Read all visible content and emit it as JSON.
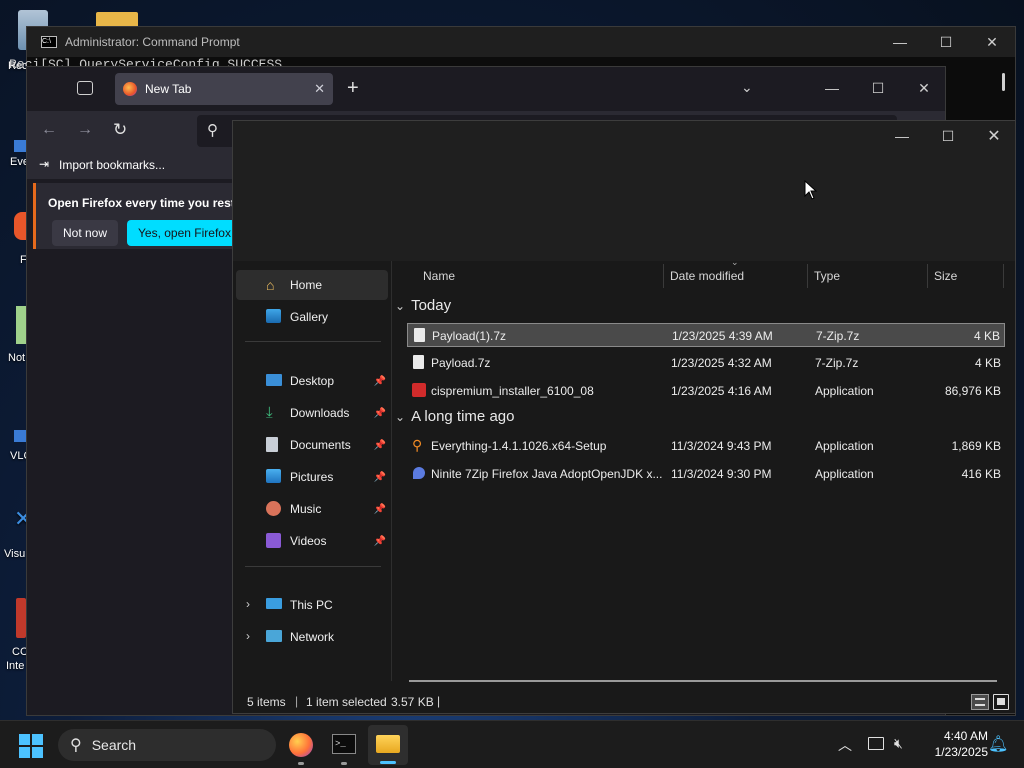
{
  "desktop": {
    "icons": [
      {
        "label": "Recy",
        "icon": "recycle-bin-icon"
      },
      {
        "label": "Eve",
        "icon": "everything-shortcut-icon"
      },
      {
        "label": "F",
        "icon": "firefox-shortcut-icon"
      },
      {
        "label": "Not",
        "icon": "notepad-shortcut-icon"
      },
      {
        "label": "VLC",
        "icon": "vlc-shortcut-icon"
      },
      {
        "label": "Visu",
        "icon": "visual-studio-shortcut-icon"
      },
      {
        "label": "CC",
        "icon": "ccleaner-shortcut-icon"
      },
      {
        "label": "Inte",
        "icon": "intel-shortcut-icon"
      }
    ]
  },
  "cmd": {
    "title": "Administrator: Command Prompt",
    "output": "Reci[SC] QueryServiceConfig SUCCESS"
  },
  "firefox": {
    "tab_title": "New Tab",
    "import_bookmarks": "Import bookmarks...",
    "notification_text": "Open Firefox every time you resta",
    "not_now": "Not now",
    "yes_open": "Yes, open Firefox"
  },
  "explorer": {
    "nav": {
      "home": "Home",
      "gallery": "Gallery",
      "desktop": "Desktop",
      "downloads": "Downloads",
      "documents": "Documents",
      "pictures": "Pictures",
      "music": "Music",
      "videos": "Videos",
      "this_pc": "This PC",
      "network": "Network"
    },
    "columns": {
      "name": "Name",
      "date": "Date modified",
      "type": "Type",
      "size": "Size"
    },
    "groups": [
      {
        "label": "Today",
        "files": [
          {
            "name": "Payload(1).7z",
            "date": "1/23/2025 4:39 AM",
            "type": "7-Zip.7z",
            "size": "4 KB",
            "icon": "file-icon",
            "selected": true
          },
          {
            "name": "Payload.7z",
            "date": "1/23/2025 4:32 AM",
            "type": "7-Zip.7z",
            "size": "4 KB",
            "icon": "file-icon",
            "selected": false
          },
          {
            "name": "cispremium_installer_6100_08",
            "date": "1/23/2025 4:16 AM",
            "type": "Application",
            "size": "86,976 KB",
            "icon": "comodo-installer-icon",
            "selected": false
          }
        ]
      },
      {
        "label": "A long time ago",
        "files": [
          {
            "name": "Everything-1.4.1.1026.x64-Setup",
            "date": "11/3/2024 9:43 PM",
            "type": "Application",
            "size": "1,869 KB",
            "icon": "everything-setup-icon",
            "selected": false
          },
          {
            "name": "Ninite 7Zip Firefox Java AdoptOpenJDK x...",
            "date": "11/3/2024 9:30 PM",
            "type": "Application",
            "size": "416 KB",
            "icon": "ninite-icon",
            "selected": false
          }
        ]
      }
    ],
    "status": {
      "items": "5 items",
      "selected": "1 item selected",
      "sel_size": "3.57 KB"
    }
  },
  "taskbar": {
    "search_label": "Search",
    "time": "4:40 AM",
    "date": "1/23/2025"
  },
  "colors": {
    "firefox_accent": "#00ddff",
    "selection": "#4a4a4a",
    "taskbar_active": "#4cc2ff"
  }
}
